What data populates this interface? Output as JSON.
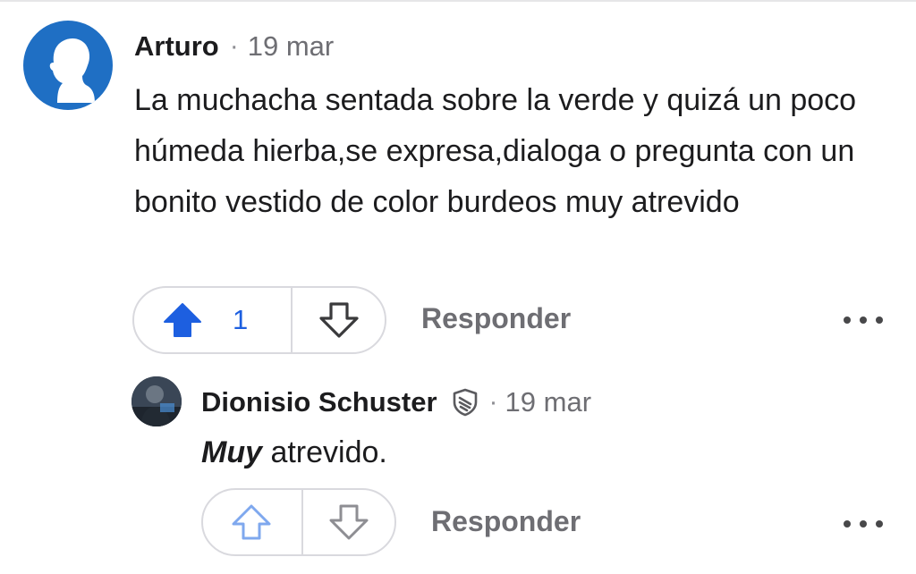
{
  "comment": {
    "author": "Arturo",
    "separator": "·",
    "date": "19 mar",
    "text": "La muchacha sentada sobre la verde y quizá un poco húmeda hierba,se expresa,dialoga o pregunta con un bonito vestido de color burdeos muy atrevido",
    "votes": {
      "count": "1",
      "upvoted": true
    },
    "reply_label": "Responder",
    "more_icon": "more-horizontal-icon",
    "avatar_color": "#1f6fc4"
  },
  "reply": {
    "author": "Dionisio Schuster",
    "badge_icon": "shield-badge-icon",
    "separator": "·",
    "date": "19 mar",
    "text_emphasis": "Muy",
    "text_rest": " atrevido.",
    "reply_label": "Responder",
    "more_icon": "more-horizontal-icon"
  },
  "colors": {
    "upvote_active": "#1d5fe0",
    "upvote_inactive": "#7fa8ee",
    "muted_text": "#6e6e73"
  }
}
